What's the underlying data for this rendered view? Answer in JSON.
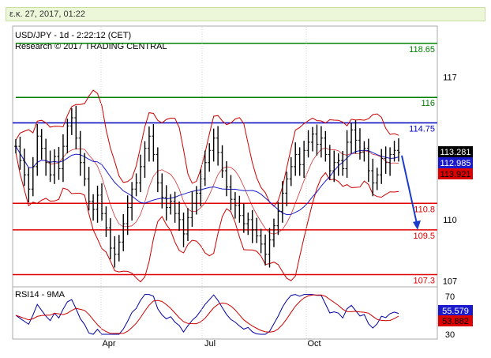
{
  "timestamp": "ε.κ. 27, 2017, 01:22",
  "header": {
    "symbol_line": "USD/JPY - 1d - 2:22:12 (CET)",
    "research_line": "Research © 2017 TRADING CENTRAL"
  },
  "rsi_header": "RSI14 - 9MA",
  "colors": {
    "green": "#008000",
    "blue": "#0000c0",
    "red": "#e00000",
    "ma_blue": "#1a1acc",
    "bb_red": "#cc0000",
    "price": "#000000"
  },
  "chart_data": [
    {
      "type": "line",
      "title": "USD/JPY - 1d - 2:22:12 (CET)",
      "subtitle": "Research © 2017 TRADING CENTRAL",
      "ylim": [
        106.7,
        119.5
      ],
      "y_ticks": [
        117,
        110,
        107
      ],
      "x_ticks": [
        "Apr",
        "Jul",
        "Oct"
      ],
      "levels": [
        {
          "value": 118.65,
          "label": "118.65",
          "color": "green"
        },
        {
          "value": 116,
          "label": "116",
          "color": "green"
        },
        {
          "value": 114.75,
          "label": "114.75",
          "color": "blue"
        },
        {
          "value": 110.8,
          "label": "110.8",
          "color": "red"
        },
        {
          "value": 109.5,
          "label": "109.5",
          "color": "red"
        },
        {
          "value": 107.3,
          "label": "107.3",
          "color": "red"
        }
      ],
      "price_badges": [
        {
          "value": 113.281,
          "label": "113.281",
          "bg": "#000000",
          "fg": "#ffffff"
        },
        {
          "value": 112.985,
          "label": "112.985",
          "bg": "#1a1acc",
          "fg": "#ffffff"
        },
        {
          "value": 113.921,
          "label": "113.921",
          "bg": "#dd0000",
          "fg": "#000000"
        }
      ],
      "close_series": [
        113.6,
        112.9,
        112.2,
        111.5,
        112.6,
        114.1,
        113.5,
        112.8,
        112.2,
        113.1,
        112.5,
        113.6,
        114.6,
        115.0,
        114.0,
        112.8,
        112.0,
        110.9,
        110.5,
        111.2,
        110.3,
        109.6,
        108.6,
        108.3,
        108.9,
        109.8,
        110.6,
        111.5,
        111.8,
        112.6,
        113.5,
        114.1,
        113.2,
        111.8,
        111.1,
        110.6,
        110.9,
        110.3,
        110.0,
        109.3,
        110.1,
        110.8,
        111.3,
        112.0,
        112.8,
        113.4,
        114.0,
        113.3,
        112.4,
        111.6,
        111.0,
        110.7,
        110.2,
        109.8,
        110.0,
        109.5,
        109.2,
        108.8,
        108.3,
        109.0,
        109.7,
        110.4,
        111.3,
        112.0,
        112.6,
        113.2,
        112.7,
        113.4,
        113.8,
        114.2,
        113.7,
        114.0,
        113.2,
        112.4,
        112.8,
        112.9,
        112.5,
        113.8,
        114.4,
        113.9,
        113.3,
        113.5,
        112.4,
        111.8,
        112.2,
        113.0,
        112.8,
        113.2,
        113.4,
        113.3
      ]
    },
    {
      "type": "line",
      "title": "RSI14 - 9MA",
      "ylim": [
        30,
        70
      ],
      "y_ticks": [
        70,
        30
      ],
      "rsi_values": [
        55.579,
        53.882
      ],
      "rsi_labels": [
        "55.579",
        "53.882"
      ]
    }
  ]
}
